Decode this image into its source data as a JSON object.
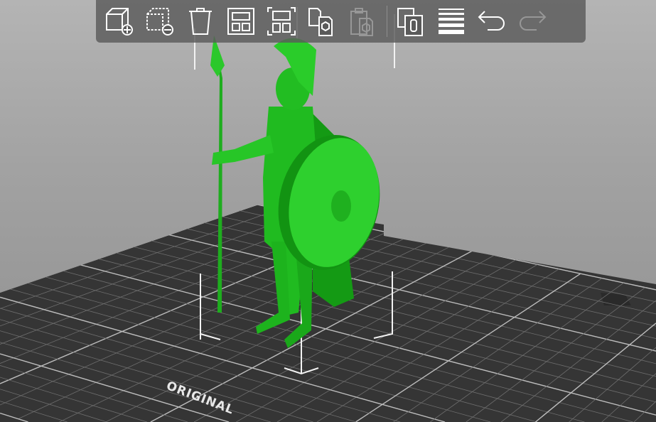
{
  "toolbar": {
    "items": [
      {
        "name": "add",
        "icon": "add-object-icon",
        "enabled": true
      },
      {
        "name": "delete",
        "icon": "delete-object-icon",
        "enabled": true
      },
      {
        "name": "delete-all",
        "icon": "trash-icon",
        "enabled": true
      },
      {
        "name": "arrange",
        "icon": "arrange-icon",
        "enabled": true
      },
      {
        "name": "arrange-selection",
        "icon": "arrange-selection-icon",
        "enabled": true
      },
      {
        "name": "copy",
        "icon": "copy-icon",
        "enabled": true
      },
      {
        "name": "paste",
        "icon": "paste-icon",
        "enabled": false
      },
      {
        "name": "instances",
        "icon": "instances-icon",
        "enabled": true
      },
      {
        "name": "layers",
        "icon": "layers-icon",
        "enabled": true
      },
      {
        "name": "undo",
        "icon": "undo-icon",
        "enabled": true
      },
      {
        "name": "redo",
        "icon": "redo-icon",
        "enabled": false
      }
    ]
  },
  "bed": {
    "label": "ORIGINAL"
  },
  "colors": {
    "model": "#22c322",
    "model_shade": "#0f8f0f",
    "bed": "#3a3a3a",
    "grid": "#6e6e6e"
  }
}
